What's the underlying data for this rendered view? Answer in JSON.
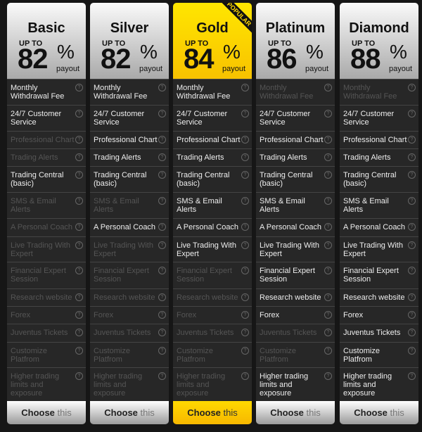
{
  "colors": {
    "gold": "#ffd800",
    "dark": "#272727"
  },
  "labels": {
    "up_to": "UP TO",
    "percent": "%",
    "payout": "payout",
    "choose": "Choose",
    "this": "this",
    "popular": "POPULAR",
    "help_icon": "?"
  },
  "features": [
    "Monthly Withdrawal Fee",
    "24/7 Customer Service",
    "Professional Chart",
    "Trading Alerts",
    "Trading Central (basic)",
    "SMS & Email Alerts",
    "A Personal Coach",
    "Live Trading With Expert",
    "Financial Expert Session",
    "Research website",
    "Forex",
    "Juventus Tickets",
    "Customize Platfrom",
    "Higher trading limits and exposure"
  ],
  "plans": [
    {
      "name": "Basic",
      "payout": "82",
      "popular": false,
      "enabled": [
        1,
        1,
        0,
        0,
        1,
        0,
        0,
        0,
        0,
        0,
        0,
        0,
        0,
        0
      ]
    },
    {
      "name": "Silver",
      "payout": "82",
      "popular": false,
      "enabled": [
        1,
        1,
        1,
        1,
        1,
        0,
        1,
        0,
        0,
        0,
        0,
        0,
        0,
        0
      ]
    },
    {
      "name": "Gold",
      "payout": "84",
      "popular": true,
      "enabled": [
        1,
        1,
        1,
        1,
        1,
        1,
        1,
        1,
        0,
        0,
        0,
        0,
        0,
        0
      ]
    },
    {
      "name": "Platinum",
      "payout": "86",
      "popular": false,
      "enabled": [
        0,
        1,
        1,
        1,
        1,
        1,
        1,
        1,
        1,
        1,
        1,
        0,
        0,
        1
      ]
    },
    {
      "name": "Diamond",
      "payout": "88",
      "popular": false,
      "enabled": [
        0,
        1,
        1,
        1,
        1,
        1,
        1,
        1,
        1,
        1,
        1,
        1,
        1,
        1
      ]
    }
  ]
}
